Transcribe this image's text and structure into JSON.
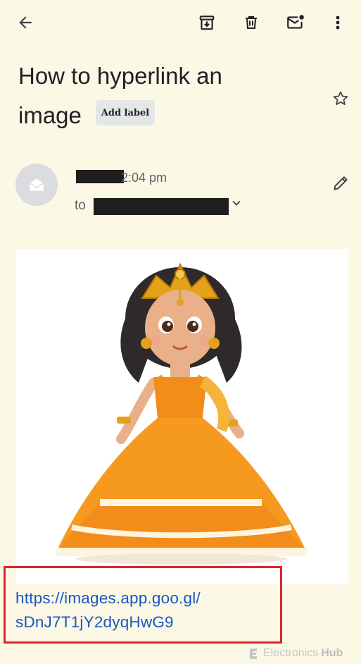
{
  "toolbar": {
    "back_icon": "arrow-back-icon",
    "archive_icon": "archive-icon",
    "delete_icon": "delete-icon",
    "mark_unread_icon": "mark-unread-icon",
    "more_icon": "more-vert-icon"
  },
  "email": {
    "subject_line_1": "How to hyperlink an",
    "subject_line_2": "image",
    "add_label_text": "Add label",
    "star_icon": "star-outline-icon",
    "time": "2:04 pm",
    "to_label": "to",
    "expand_icon": "chevron-down-icon",
    "edit_icon": "pencil-icon"
  },
  "body": {
    "link_line_1": "https://images.app.goo.gl/",
    "link_line_2": "sDnJ7T1jY2dyqHwG9"
  },
  "watermark": {
    "part1": "Electronics",
    "part2": "Hub"
  },
  "colors": {
    "background": "#fbf8e5",
    "link": "#1a56c4",
    "highlight_border": "#e0242b"
  }
}
